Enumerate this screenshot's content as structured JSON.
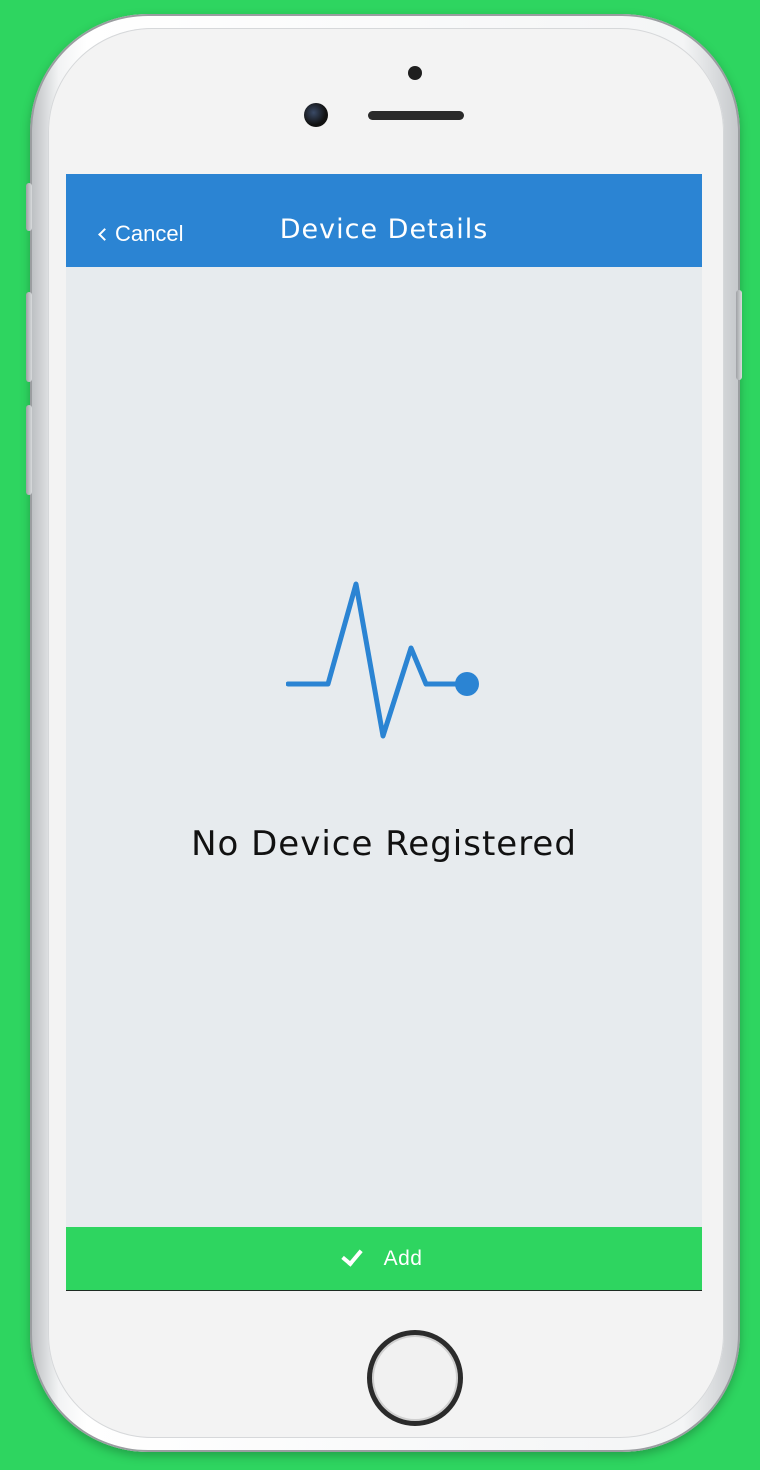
{
  "navbar": {
    "cancel_label": "Cancel",
    "title": "Device Details"
  },
  "empty_state": {
    "icon": "pulse-icon",
    "message": "No Device Registered"
  },
  "footer": {
    "add_label": "Add",
    "add_icon": "check-icon"
  },
  "colors": {
    "accent_blue": "#2b84d3",
    "add_green": "#2ed560",
    "screen_background": "#e7ebee"
  }
}
